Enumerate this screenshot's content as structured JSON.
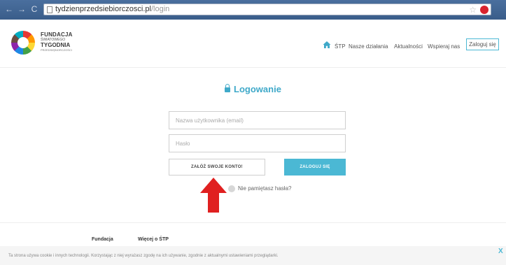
{
  "browser": {
    "back": "←",
    "forward": "→",
    "reload": "C",
    "url_host": "tydzienprzedsiebiorczosci.pl",
    "url_path": "/login"
  },
  "logo": {
    "line1": "FUNDACJA",
    "line2": "ŚWIATOWEGO",
    "line3": "TYGODNIA",
    "line4": "PRZEDSIĘBIORCZOŚCI"
  },
  "nav": {
    "items": [
      "ŚTP",
      "Nasze działania",
      "Aktualności",
      "Wspieraj nas"
    ],
    "login": "Zaloguj się"
  },
  "login": {
    "title": "Logowanie",
    "username_placeholder": "Nazwa użytkownika (email)",
    "password_placeholder": "Hasło",
    "register_label": "ZAŁÓŻ SWOJE KONTO!",
    "submit_label": "ZALOGUJ SIĘ",
    "forgot_label": "Nie pamiętasz hasła?"
  },
  "footer": {
    "links": [
      "Fundacja",
      "Więcej o ŚTP"
    ]
  },
  "cookie": {
    "text": "Ta strona używa cookie i innych technologii. Korzystając z niej wyrażasz zgodę na ich używanie, zgodnie z aktualnymi ustawieniami przeglądarki.",
    "close": "X"
  },
  "colors": {
    "accent": "#4bb8d4",
    "title": "#3fa9c9",
    "arrow": "#e02020",
    "chrome": "#3f6391"
  },
  "icons": [
    "home-icon",
    "lock-icon",
    "help-icon",
    "star-icon",
    "arrow-up-icon"
  ]
}
